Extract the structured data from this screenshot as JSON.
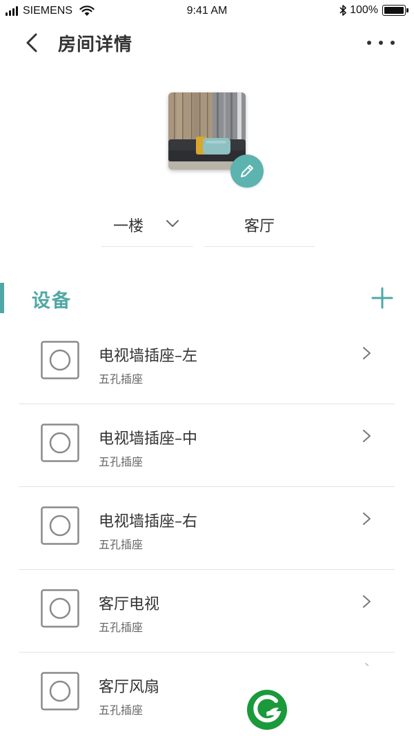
{
  "status_bar": {
    "carrier": "SIEMENS",
    "time": "9:41 AM",
    "battery": "100%",
    "battery_level": 1.0
  },
  "nav": {
    "title": "房间详情",
    "back_icon": "chevron-left-icon",
    "more_icon": "more-horizontal-icon"
  },
  "room": {
    "floor": "一楼",
    "name": "客厅",
    "edit_icon": "pencil-icon"
  },
  "devices_section": {
    "title": "设备",
    "add_icon": "plus-icon",
    "accent_color": "#4fa8a4"
  },
  "devices": [
    {
      "name": "电视墙插座–左",
      "type": "五孔插座"
    },
    {
      "name": "电视墙插座–中",
      "type": "五孔插座"
    },
    {
      "name": "电视墙插座–右",
      "type": "五孔插座"
    },
    {
      "name": "客厅电视",
      "type": "五孔插座"
    },
    {
      "name": "客厅风扇",
      "type": "五孔插座"
    }
  ],
  "colors": {
    "accent": "#4fa8a4",
    "edit_button": "#5cb3b0",
    "logo_green": "#1a9a3a"
  }
}
